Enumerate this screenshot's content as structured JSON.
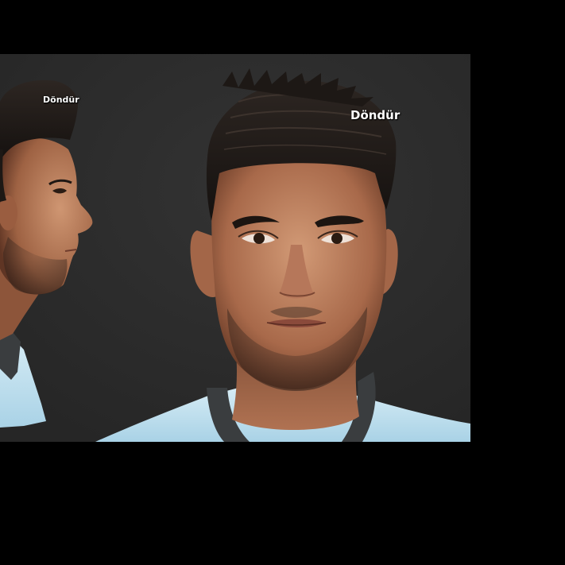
{
  "viewer": {
    "side_view": {
      "rotate_label": "Döndür"
    },
    "front_view": {
      "rotate_label": "Döndür"
    }
  },
  "colors": {
    "page_background": "#000000",
    "viewport_background": "#2c2c2c",
    "shirt": "#bfe0ee",
    "collar": "#3a3d3f",
    "skin": "#b77a55",
    "hair": "#1d1815"
  }
}
